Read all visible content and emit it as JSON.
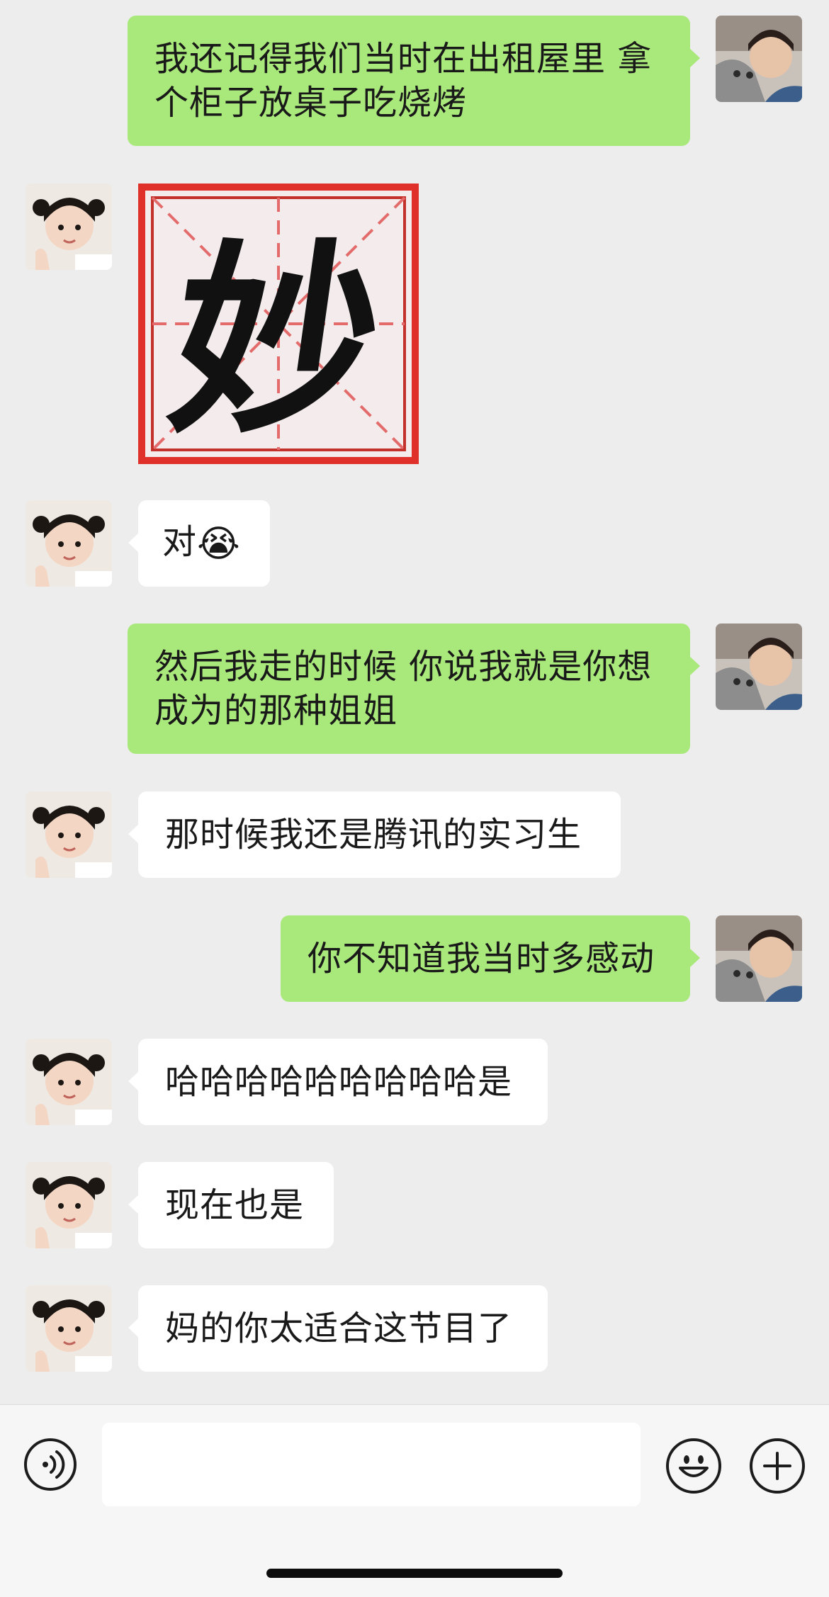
{
  "messages": [
    {
      "sender": "me",
      "type": "text",
      "text": "我还记得我们当时在出租屋里 拿个柜子放桌子吃烧烤"
    },
    {
      "sender": "other",
      "type": "sticker",
      "text": "妙"
    },
    {
      "sender": "other",
      "type": "text",
      "text": "对",
      "emoji": "😭"
    },
    {
      "sender": "me",
      "type": "text",
      "text": "然后我走的时候 你说我就是你想成为的那种姐姐"
    },
    {
      "sender": "other",
      "type": "text",
      "text": "那时候我还是腾讯的实习生"
    },
    {
      "sender": "me",
      "type": "text",
      "text": "你不知道我当时多感动"
    },
    {
      "sender": "other",
      "type": "text",
      "text": "哈哈哈哈哈哈哈哈哈是"
    },
    {
      "sender": "other",
      "type": "text",
      "text": "现在也是"
    },
    {
      "sender": "other",
      "type": "text",
      "text": "妈的你太适合这节目了"
    }
  ],
  "input_bar": {
    "input_value": "",
    "icons": [
      "voice-icon",
      "emoji-icon",
      "plus-icon"
    ]
  },
  "colors": {
    "background": "#ededed",
    "my_bubble": "#a9e87a",
    "other_bubble": "#ffffff",
    "sticker_frame": "#e0302a"
  }
}
